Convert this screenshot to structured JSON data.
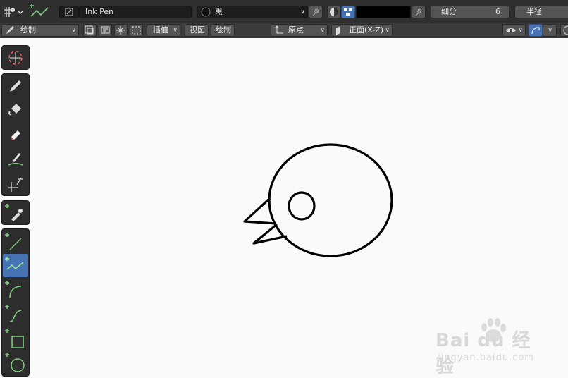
{
  "header": {
    "brush_name": "Ink Pen",
    "material": "黑",
    "subdivision_label": "细分",
    "subdivision_value": "6",
    "radius_label": "半径"
  },
  "subheader": {
    "mode": "绘制",
    "interpolate": "插值",
    "view_menu": "视图",
    "draw_menu": "绘制",
    "origin": "原点",
    "orientation": "正面(X-Z)"
  },
  "colors": {
    "accent": "#4772b3",
    "canvas": "#fafafa",
    "header": "#2f2f2f",
    "stroke": "#000000"
  },
  "watermark": {
    "brand_text": "Bai du 经验",
    "url": "jingyan.baidu.com"
  }
}
